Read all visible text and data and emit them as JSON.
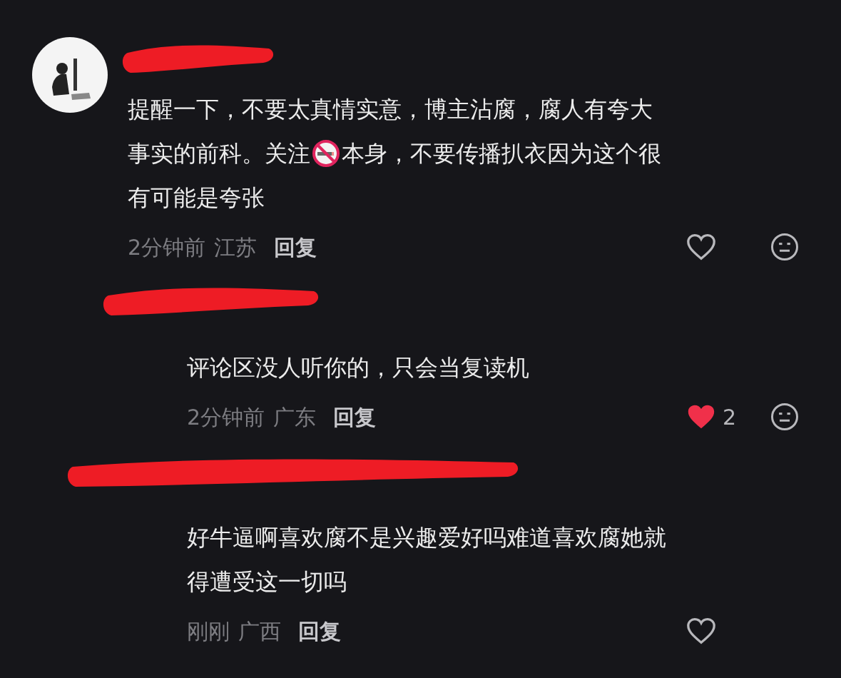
{
  "comments": [
    {
      "kind": "top",
      "text_lines": [
        [
          "提醒一下，不要太真情实意，博主沾腐，腐人有夸大"
        ],
        [
          "事实的前科。关注",
          "本身，不要传播扒衣因为这个很"
        ],
        [
          "有可能是夸张"
        ]
      ],
      "time": "2分钟前",
      "location": "江苏",
      "reply_label": "回复",
      "liked": false,
      "dislike_button": true
    },
    {
      "kind": "reply",
      "text_lines": [
        [
          "评论区没人听你的，只会当复读机"
        ]
      ],
      "time": "2分钟前",
      "location": "广东",
      "reply_label": "回复",
      "liked": true,
      "like_count": "2",
      "dislike_button": true
    },
    {
      "kind": "reply",
      "text_lines": [
        [
          "好牛逼啊喜欢腐不是兴趣爱好吗难道喜欢腐她就"
        ],
        [
          "得遭受这一切吗"
        ]
      ],
      "time": "刚刚",
      "location": "广西",
      "reply_label": "回复",
      "liked": false,
      "dislike_button": false
    }
  ]
}
